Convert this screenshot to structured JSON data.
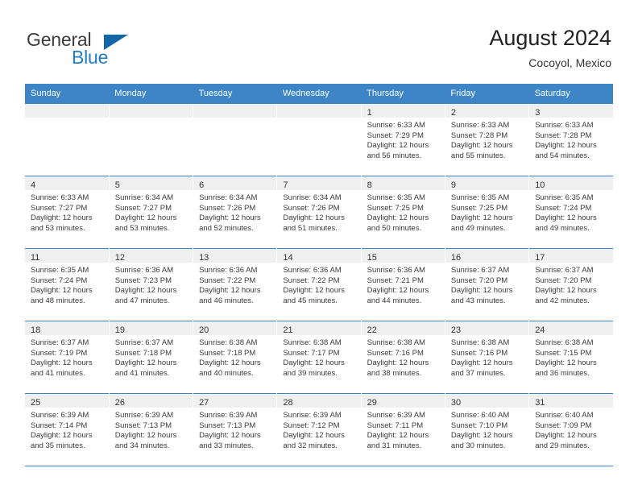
{
  "brand": {
    "name_top": "General",
    "name_bottom": "Blue",
    "triangle_color": "#1366a8",
    "blue_color": "#1f7ec4"
  },
  "header": {
    "title": "August 2024",
    "location": "Cocoyol, Mexico"
  },
  "theme": {
    "header_bg": "#3d85c6",
    "daynum_band_bg": "#efefef",
    "grid_line": "#3d85c6",
    "text": "#3a3a3a"
  },
  "weekdays": [
    "Sunday",
    "Monday",
    "Tuesday",
    "Wednesday",
    "Thursday",
    "Friday",
    "Saturday"
  ],
  "weeks": [
    [
      {
        "day": "",
        "lines": []
      },
      {
        "day": "",
        "lines": []
      },
      {
        "day": "",
        "lines": []
      },
      {
        "day": "",
        "lines": []
      },
      {
        "day": "1",
        "lines": [
          "Sunrise: 6:33 AM",
          "Sunset: 7:29 PM",
          "Daylight: 12 hours",
          "and 56 minutes."
        ]
      },
      {
        "day": "2",
        "lines": [
          "Sunrise: 6:33 AM",
          "Sunset: 7:28 PM",
          "Daylight: 12 hours",
          "and 55 minutes."
        ]
      },
      {
        "day": "3",
        "lines": [
          "Sunrise: 6:33 AM",
          "Sunset: 7:28 PM",
          "Daylight: 12 hours",
          "and 54 minutes."
        ]
      }
    ],
    [
      {
        "day": "4",
        "lines": [
          "Sunrise: 6:33 AM",
          "Sunset: 7:27 PM",
          "Daylight: 12 hours",
          "and 53 minutes."
        ]
      },
      {
        "day": "5",
        "lines": [
          "Sunrise: 6:34 AM",
          "Sunset: 7:27 PM",
          "Daylight: 12 hours",
          "and 53 minutes."
        ]
      },
      {
        "day": "6",
        "lines": [
          "Sunrise: 6:34 AM",
          "Sunset: 7:26 PM",
          "Daylight: 12 hours",
          "and 52 minutes."
        ]
      },
      {
        "day": "7",
        "lines": [
          "Sunrise: 6:34 AM",
          "Sunset: 7:26 PM",
          "Daylight: 12 hours",
          "and 51 minutes."
        ]
      },
      {
        "day": "8",
        "lines": [
          "Sunrise: 6:35 AM",
          "Sunset: 7:25 PM",
          "Daylight: 12 hours",
          "and 50 minutes."
        ]
      },
      {
        "day": "9",
        "lines": [
          "Sunrise: 6:35 AM",
          "Sunset: 7:25 PM",
          "Daylight: 12 hours",
          "and 49 minutes."
        ]
      },
      {
        "day": "10",
        "lines": [
          "Sunrise: 6:35 AM",
          "Sunset: 7:24 PM",
          "Daylight: 12 hours",
          "and 49 minutes."
        ]
      }
    ],
    [
      {
        "day": "11",
        "lines": [
          "Sunrise: 6:35 AM",
          "Sunset: 7:24 PM",
          "Daylight: 12 hours",
          "and 48 minutes."
        ]
      },
      {
        "day": "12",
        "lines": [
          "Sunrise: 6:36 AM",
          "Sunset: 7:23 PM",
          "Daylight: 12 hours",
          "and 47 minutes."
        ]
      },
      {
        "day": "13",
        "lines": [
          "Sunrise: 6:36 AM",
          "Sunset: 7:22 PM",
          "Daylight: 12 hours",
          "and 46 minutes."
        ]
      },
      {
        "day": "14",
        "lines": [
          "Sunrise: 6:36 AM",
          "Sunset: 7:22 PM",
          "Daylight: 12 hours",
          "and 45 minutes."
        ]
      },
      {
        "day": "15",
        "lines": [
          "Sunrise: 6:36 AM",
          "Sunset: 7:21 PM",
          "Daylight: 12 hours",
          "and 44 minutes."
        ]
      },
      {
        "day": "16",
        "lines": [
          "Sunrise: 6:37 AM",
          "Sunset: 7:20 PM",
          "Daylight: 12 hours",
          "and 43 minutes."
        ]
      },
      {
        "day": "17",
        "lines": [
          "Sunrise: 6:37 AM",
          "Sunset: 7:20 PM",
          "Daylight: 12 hours",
          "and 42 minutes."
        ]
      }
    ],
    [
      {
        "day": "18",
        "lines": [
          "Sunrise: 6:37 AM",
          "Sunset: 7:19 PM",
          "Daylight: 12 hours",
          "and 41 minutes."
        ]
      },
      {
        "day": "19",
        "lines": [
          "Sunrise: 6:37 AM",
          "Sunset: 7:18 PM",
          "Daylight: 12 hours",
          "and 41 minutes."
        ]
      },
      {
        "day": "20",
        "lines": [
          "Sunrise: 6:38 AM",
          "Sunset: 7:18 PM",
          "Daylight: 12 hours",
          "and 40 minutes."
        ]
      },
      {
        "day": "21",
        "lines": [
          "Sunrise: 6:38 AM",
          "Sunset: 7:17 PM",
          "Daylight: 12 hours",
          "and 39 minutes."
        ]
      },
      {
        "day": "22",
        "lines": [
          "Sunrise: 6:38 AM",
          "Sunset: 7:16 PM",
          "Daylight: 12 hours",
          "and 38 minutes."
        ]
      },
      {
        "day": "23",
        "lines": [
          "Sunrise: 6:38 AM",
          "Sunset: 7:16 PM",
          "Daylight: 12 hours",
          "and 37 minutes."
        ]
      },
      {
        "day": "24",
        "lines": [
          "Sunrise: 6:38 AM",
          "Sunset: 7:15 PM",
          "Daylight: 12 hours",
          "and 36 minutes."
        ]
      }
    ],
    [
      {
        "day": "25",
        "lines": [
          "Sunrise: 6:39 AM",
          "Sunset: 7:14 PM",
          "Daylight: 12 hours",
          "and 35 minutes."
        ]
      },
      {
        "day": "26",
        "lines": [
          "Sunrise: 6:39 AM",
          "Sunset: 7:13 PM",
          "Daylight: 12 hours",
          "and 34 minutes."
        ]
      },
      {
        "day": "27",
        "lines": [
          "Sunrise: 6:39 AM",
          "Sunset: 7:13 PM",
          "Daylight: 12 hours",
          "and 33 minutes."
        ]
      },
      {
        "day": "28",
        "lines": [
          "Sunrise: 6:39 AM",
          "Sunset: 7:12 PM",
          "Daylight: 12 hours",
          "and 32 minutes."
        ]
      },
      {
        "day": "29",
        "lines": [
          "Sunrise: 6:39 AM",
          "Sunset: 7:11 PM",
          "Daylight: 12 hours",
          "and 31 minutes."
        ]
      },
      {
        "day": "30",
        "lines": [
          "Sunrise: 6:40 AM",
          "Sunset: 7:10 PM",
          "Daylight: 12 hours",
          "and 30 minutes."
        ]
      },
      {
        "day": "31",
        "lines": [
          "Sunrise: 6:40 AM",
          "Sunset: 7:09 PM",
          "Daylight: 12 hours",
          "and 29 minutes."
        ]
      }
    ]
  ]
}
